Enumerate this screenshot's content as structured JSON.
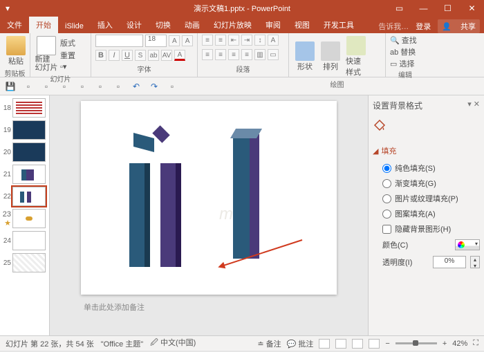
{
  "titlebar": {
    "title": "演示文稿1.pptx - PowerPoint"
  },
  "menu": {
    "tabs": [
      "文件",
      "开始",
      "iSlide",
      "插入",
      "设计",
      "切换",
      "动画",
      "幻灯片放映",
      "审阅",
      "视图",
      "开发工具"
    ],
    "tell_me": "告诉我…",
    "login": "登录",
    "share": "共享"
  },
  "ribbon": {
    "clipboard": {
      "paste": "粘贴",
      "label": "剪贴板"
    },
    "slides": {
      "new": "新建\n幻灯片",
      "layout": "版式",
      "reset": "重置",
      "label": "幻灯片"
    },
    "font": {
      "size": "18",
      "label": "字体"
    },
    "paragraph": {
      "label": "段落"
    },
    "drawing": {
      "shapes": "形状",
      "arrange": "排列",
      "quick": "快速样式",
      "label": "绘图"
    },
    "editing": {
      "find": "查找",
      "replace": "替换",
      "select": "选择",
      "label": "编辑"
    }
  },
  "thumbs": {
    "numbers": [
      "18",
      "19",
      "20",
      "21",
      "22",
      "23",
      "24",
      "25"
    ],
    "active": 4,
    "star_index": 5
  },
  "notes_placeholder": "单击此处添加备注",
  "pane": {
    "title": "设置背景格式",
    "section": "填充",
    "options": {
      "solid": "纯色填充(S)",
      "gradient": "渐变填充(G)",
      "picture": "图片或纹理填充(P)",
      "pattern": "图案填充(A)",
      "hide": "隐藏背景图形(H)"
    },
    "color_label": "颜色(C)",
    "trans_label": "透明度(I)",
    "trans_value": "0%"
  },
  "status": {
    "slide": "幻灯片 第 22 张，共 54 张",
    "theme": "\"Office 主题\"",
    "lang": "中文(中国)",
    "notes": "备注",
    "comments": "批注",
    "zoom": "42%"
  }
}
